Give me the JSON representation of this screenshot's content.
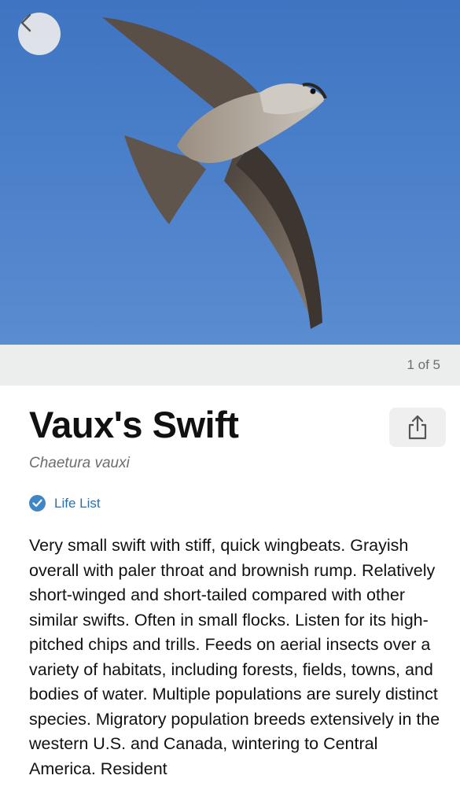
{
  "hero": {
    "image_subject": "Vaux's Swift in flight against blue sky",
    "image_counter": "1 of 5"
  },
  "nav": {
    "back_icon": "chevron-left-icon"
  },
  "species": {
    "common_name": "Vaux's Swift",
    "scientific_name": "Chaetura vauxi",
    "share_icon": "share-icon",
    "badge": {
      "icon": "checkmark-circle-icon",
      "label": "Life List",
      "color": "#3f86c6"
    },
    "description": "Very small swift with stiff, quick wingbeats. Grayish overall with paler throat and brownish rump. Relatively short-winged and short-tailed compared with other similar swifts. Often in small flocks. Listen for its high-pitched chips and trills. Feeds on aerial insects over a variety of habitats, including forests, fields, towns, and bodies of water. Multiple populations are surely distinct species. Migratory population breeds extensively in the western U.S. and Canada, wintering to Central America. Resident"
  }
}
